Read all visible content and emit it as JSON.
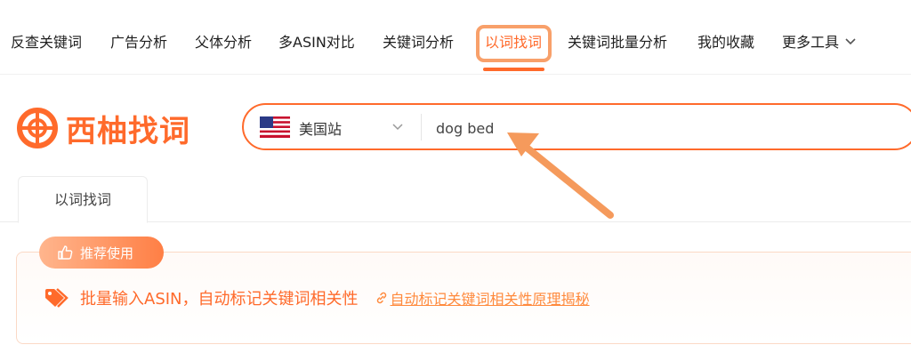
{
  "nav": {
    "items": [
      {
        "label": "反查关键词"
      },
      {
        "label": "广告分析"
      },
      {
        "label": "父体分析"
      },
      {
        "label": "多ASIN对比"
      },
      {
        "label": "关键词分析"
      },
      {
        "label": "以词找词",
        "active": true
      },
      {
        "label": "关键词批量分析"
      },
      {
        "label": "我的收藏"
      },
      {
        "label": "更多工具"
      }
    ]
  },
  "logo": {
    "text": "西柚找词",
    "icon": "grapefruit-logo-icon"
  },
  "search": {
    "marketplace": "美国站",
    "marketplace_flag": "us-flag-icon",
    "value": "dog bed"
  },
  "tabs": [
    {
      "label": "以词找词"
    }
  ],
  "recommendation": {
    "badge": "推荐使用",
    "badge_icon": "thumbs-up-icon",
    "text": "批量输入ASIN，自动标记关键词相关性",
    "text_icon": "tag-icon",
    "link": "自动标记关键词相关性原理揭秘",
    "link_icon": "link-icon"
  },
  "colors": {
    "accent": "#ff6a2b",
    "highlight": "#f8a06a",
    "annotation_arrow": "#f59a5c"
  }
}
